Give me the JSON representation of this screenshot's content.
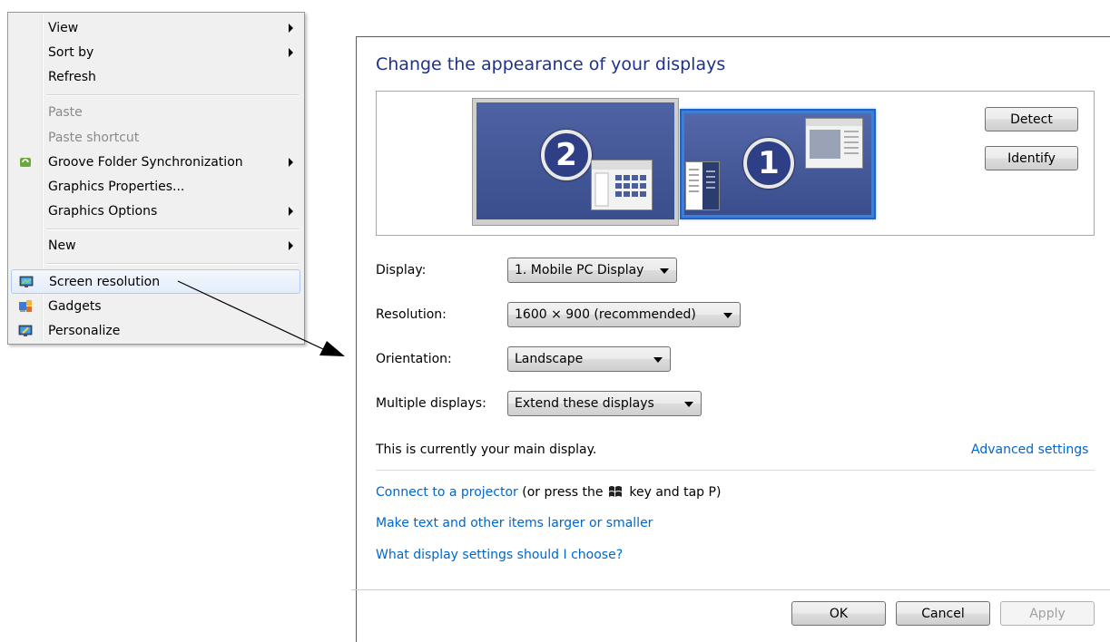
{
  "context_menu": {
    "items": [
      {
        "label": "View",
        "submenu": true,
        "disabled": false
      },
      {
        "label": "Sort by",
        "submenu": true,
        "disabled": false
      },
      {
        "label": "Refresh",
        "submenu": false,
        "disabled": false
      },
      {
        "label": "Paste",
        "submenu": false,
        "disabled": true
      },
      {
        "label": "Paste shortcut",
        "submenu": false,
        "disabled": true
      },
      {
        "label": "Groove Folder Synchronization",
        "submenu": true,
        "disabled": false,
        "icon": "groove-icon"
      },
      {
        "label": "Graphics Properties...",
        "submenu": false,
        "disabled": false
      },
      {
        "label": "Graphics Options",
        "submenu": true,
        "disabled": false
      },
      {
        "label": "New",
        "submenu": true,
        "disabled": false
      },
      {
        "label": "Screen resolution",
        "submenu": false,
        "disabled": false,
        "icon": "screen-resolution-icon",
        "highlighted": true
      },
      {
        "label": "Gadgets",
        "submenu": false,
        "disabled": false,
        "icon": "gadgets-icon"
      },
      {
        "label": "Personalize",
        "submenu": false,
        "disabled": false,
        "icon": "personalize-icon"
      }
    ]
  },
  "dialog": {
    "title": "Change the appearance of your displays",
    "monitors": {
      "secondary_number": "2",
      "primary_number": "1"
    },
    "detect_label": "Detect",
    "identify_label": "Identify",
    "fields": {
      "display_label": "Display:",
      "display_value": "1. Mobile PC Display",
      "resolution_label": "Resolution:",
      "resolution_value": "1600 × 900 (recommended)",
      "orientation_label": "Orientation:",
      "orientation_value": "Landscape",
      "multiple_label": "Multiple displays:",
      "multiple_value": "Extend these displays"
    },
    "main_display_text": "This is currently your main display.",
    "advanced_settings": "Advanced settings",
    "connect_projector_link": "Connect to a projector",
    "connect_projector_rest_1": "(or press the",
    "connect_projector_rest_2": "key and tap P)",
    "text_size_link": "Make text and other items larger or smaller",
    "help_link": "What display settings should I choose?",
    "ok_label": "OK",
    "cancel_label": "Cancel",
    "apply_label": "Apply"
  },
  "colors": {
    "title": "#1e3287",
    "link": "#0066cc",
    "monitor_fill": "#3a4d8c",
    "selected_border": "#1e63c6"
  }
}
